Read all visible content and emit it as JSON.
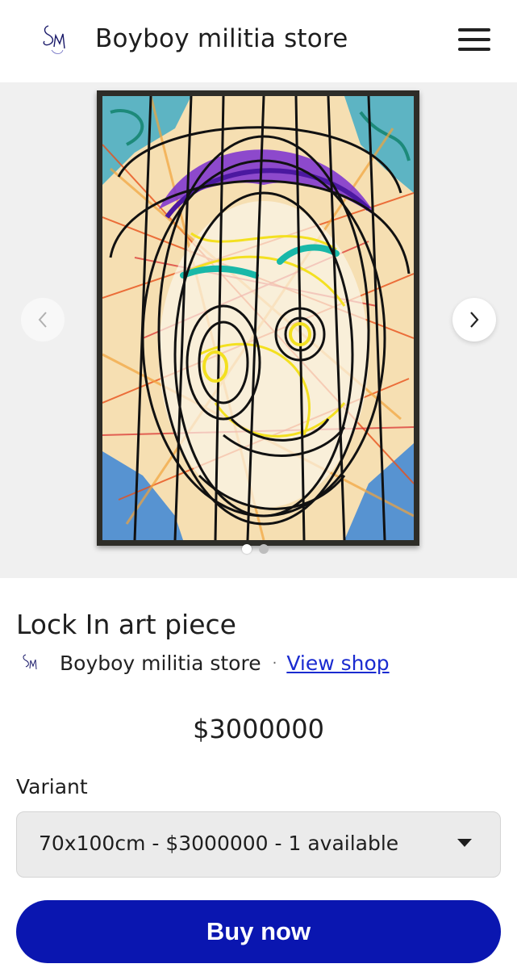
{
  "header": {
    "store_name": "Boyboy militia store",
    "logo_text": "SM",
    "menu_icon": "hamburger-menu-icon"
  },
  "gallery": {
    "image_count": 2,
    "active_index": 0,
    "prev_icon": "chevron-left-icon",
    "next_icon": "chevron-right-icon"
  },
  "product": {
    "title": "Lock In art piece",
    "shop_name": "Boyboy militia store",
    "separator": "·",
    "view_shop_label": "View shop",
    "price": "$3000000"
  },
  "variant": {
    "label": "Variant",
    "selected": "70x100cm - $3000000 - 1 available",
    "dropdown_icon": "caret-down-icon"
  },
  "actions": {
    "buy_label": "Buy now"
  },
  "colors": {
    "accent": "#0a16b0",
    "link": "#1a2bd0",
    "gallery_bg": "#f0f0f0"
  }
}
